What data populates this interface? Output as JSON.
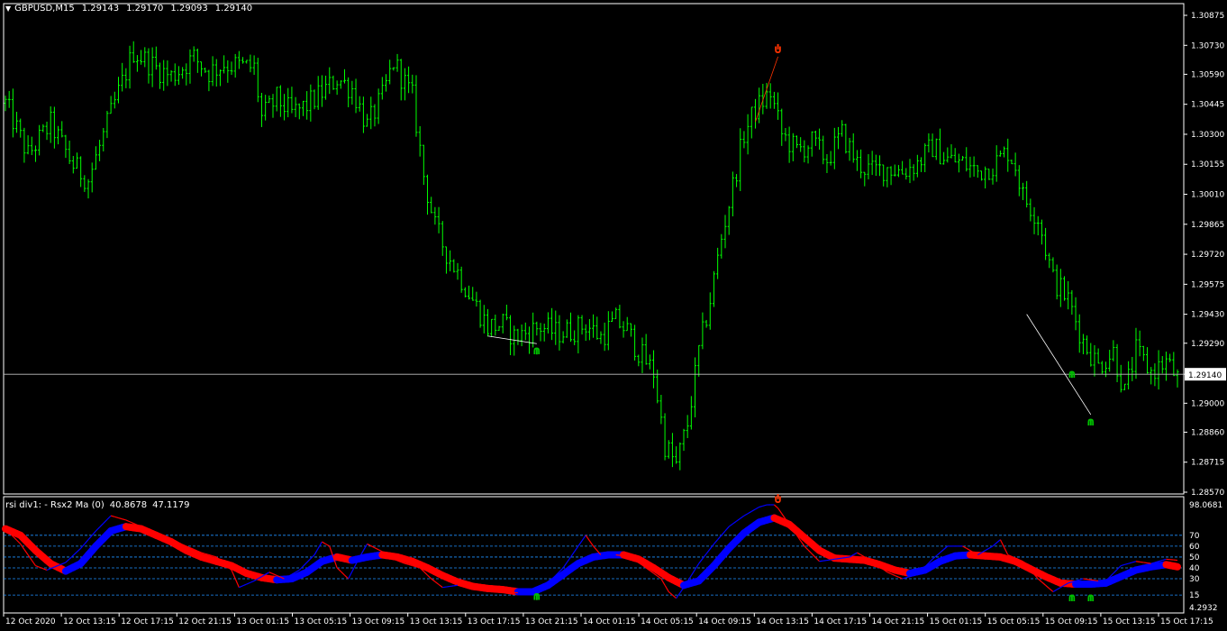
{
  "window": {
    "symbol": "GBPUSD,M15",
    "ohlc": [
      "1.29143",
      "1.29170",
      "1.29093",
      "1.29140"
    ]
  },
  "indicator": {
    "name": "rsi div1: - Rsx2 Ma (0)",
    "values": [
      "40.8678",
      "47.1179"
    ],
    "scale_max": "98.0681",
    "scale_min": "4.2932",
    "levels": [
      {
        "label": "70",
        "value": 70
      },
      {
        "label": "60",
        "value": 60
      },
      {
        "label": "50",
        "value": 50
      },
      {
        "label": "40",
        "value": 40
      },
      {
        "label": "30",
        "value": 30
      },
      {
        "label": "15",
        "value": 15
      }
    ]
  },
  "colors": {
    "background": "#000000",
    "candles": "#00ff00",
    "grid_border": "#ffffff",
    "current_price_line": "#c0c0c0",
    "rsx_up": "#0000ff",
    "rsx_down": "#ff0000",
    "level_lines": "#1e90ff",
    "arrow_up": "#00c000",
    "arrow_down": "#ff3300"
  },
  "chart_data": [
    {
      "type": "candlestick",
      "title": "GBPUSD,M15",
      "y_ticks": [
        "1.30875",
        "1.30730",
        "1.30590",
        "1.30445",
        "1.30300",
        "1.30155",
        "1.30010",
        "1.29865",
        "1.29720",
        "1.29575",
        "1.29430",
        "1.29290",
        "1.29140",
        "1.29000",
        "1.28860",
        "1.28715",
        "1.28570"
      ],
      "ylim": [
        1.2857,
        1.3098
      ],
      "current_price": "1.29140",
      "x_ticks": [
        "12 Oct 2020",
        "12 Oct 13:15",
        "12 Oct 17:15",
        "12 Oct 21:15",
        "13 Oct 01:15",
        "13 Oct 05:15",
        "13 Oct 09:15",
        "13 Oct 13:15",
        "13 Oct 17:15",
        "13 Oct 21:15",
        "14 Oct 01:15",
        "14 Oct 05:15",
        "14 Oct 09:15",
        "14 Oct 13:15",
        "14 Oct 17:15",
        "14 Oct 21:15",
        "15 Oct 01:15",
        "15 Oct 05:15",
        "15 Oct 09:15",
        "15 Oct 13:15",
        "15 Oct 17:15"
      ],
      "price_path": [
        [
          0,
          1.3045
        ],
        [
          6,
          1.302
        ],
        [
          12,
          1.3035
        ],
        [
          18,
          1.3015
        ],
        [
          22,
          1.3008
        ],
        [
          28,
          1.304
        ],
        [
          34,
          1.307
        ],
        [
          40,
          1.3062
        ],
        [
          44,
          1.3058
        ],
        [
          50,
          1.3067
        ],
        [
          54,
          1.306
        ],
        [
          58,
          1.3064
        ],
        [
          62,
          1.3063
        ],
        [
          66,
          1.3062
        ],
        [
          68,
          1.3038
        ],
        [
          72,
          1.3047
        ],
        [
          76,
          1.304
        ],
        [
          80,
          1.3044
        ],
        [
          84,
          1.305
        ],
        [
          88,
          1.3057
        ],
        [
          92,
          1.3052
        ],
        [
          96,
          1.3034
        ],
        [
          100,
          1.3048
        ],
        [
          103,
          1.3065
        ],
        [
          108,
          1.3048
        ],
        [
          111,
          1.301
        ],
        [
          114,
          1.2985
        ],
        [
          117,
          1.2973
        ],
        [
          121,
          1.296
        ],
        [
          124,
          1.295
        ],
        [
          128,
          1.2937
        ],
        [
          132,
          1.2938
        ],
        [
          135,
          1.2932
        ],
        [
          138,
          1.2934
        ],
        [
          142,
          1.2937
        ],
        [
          146,
          1.2934
        ],
        [
          150,
          1.2935
        ],
        [
          154,
          1.2938
        ],
        [
          158,
          1.2932
        ],
        [
          162,
          1.294
        ],
        [
          165,
          1.2935
        ],
        [
          168,
          1.2925
        ],
        [
          172,
          1.2915
        ],
        [
          175,
          1.288
        ],
        [
          178,
          1.287
        ],
        [
          181,
          1.289
        ],
        [
          184,
          1.2925
        ],
        [
          187,
          1.295
        ],
        [
          190,
          1.298
        ],
        [
          193,
          1.3005
        ],
        [
          196,
          1.303
        ],
        [
          199,
          1.3042
        ],
        [
          203,
          1.305
        ],
        [
          206,
          1.303
        ],
        [
          210,
          1.3022
        ],
        [
          214,
          1.3026
        ],
        [
          218,
          1.3018
        ],
        [
          222,
          1.303
        ],
        [
          226,
          1.3016
        ],
        [
          230,
          1.3012
        ],
        [
          234,
          1.3014
        ],
        [
          238,
          1.3012
        ],
        [
          242,
          1.3016
        ],
        [
          246,
          1.3024
        ],
        [
          250,
          1.3018
        ],
        [
          254,
          1.3016
        ],
        [
          258,
          1.3012
        ],
        [
          262,
          1.3015
        ],
        [
          266,
          1.3022
        ],
        [
          268,
          1.3015
        ],
        [
          270,
          1.3
        ],
        [
          274,
          1.299
        ],
        [
          278,
          1.296
        ],
        [
          282,
          1.295
        ],
        [
          286,
          1.293
        ],
        [
          290,
          1.2918
        ],
        [
          294,
          1.2925
        ],
        [
          297,
          1.2905
        ],
        [
          300,
          1.2925
        ],
        [
          304,
          1.2915
        ],
        [
          308,
          1.292
        ],
        [
          311,
          1.2912
        ]
      ],
      "arrows": [
        {
          "direction": "up",
          "bar": 141,
          "price": 1.29288
        },
        {
          "direction": "down",
          "bar": 205,
          "price": 1.30675
        },
        {
          "direction": "up",
          "bar": 283,
          "price": 1.29175
        },
        {
          "direction": "up",
          "bar": 288,
          "price": 1.28945
        }
      ],
      "divergence_lines": [
        {
          "color": "#ffffff",
          "from": [
            128,
            1.29325
          ],
          "to": [
            141,
            1.29288
          ]
        },
        {
          "color": "#ff3300",
          "from": [
            199,
            1.3036
          ],
          "to": [
            205,
            1.30675
          ]
        },
        {
          "color": "#ffffff",
          "from": [
            271,
            1.2943
          ],
          "to": [
            288,
            1.28945
          ]
        }
      ]
    },
    {
      "type": "line",
      "title": "rsi div1: - Rsx2 Ma (0)",
      "ylim": [
        4.2932,
        98.0681
      ],
      "series": [
        {
          "role": "rsx",
          "points": [
            [
              0,
              76
            ],
            [
              4,
              62
            ],
            [
              8,
              42
            ],
            [
              11,
              38
            ],
            [
              16,
              45
            ],
            [
              20,
              58
            ],
            [
              24,
              74
            ],
            [
              28,
              88
            ],
            [
              32,
              84
            ],
            [
              36,
              78
            ],
            [
              40,
              72
            ],
            [
              44,
              66
            ],
            [
              48,
              60
            ],
            [
              52,
              54
            ],
            [
              56,
              50
            ],
            [
              60,
              38
            ],
            [
              62,
              22
            ],
            [
              66,
              28
            ],
            [
              70,
              36
            ],
            [
              74,
              30
            ],
            [
              78,
              38
            ],
            [
              82,
              52
            ],
            [
              84,
              64
            ],
            [
              86,
              60
            ],
            [
              88,
              40
            ],
            [
              91,
              30
            ],
            [
              94,
              50
            ],
            [
              96,
              62
            ],
            [
              100,
              55
            ],
            [
              103,
              48
            ],
            [
              106,
              44
            ],
            [
              110,
              40
            ],
            [
              113,
              30
            ],
            [
              116,
              22
            ],
            [
              120,
              24
            ],
            [
              124,
              20
            ],
            [
              128,
              19
            ],
            [
              132,
              18
            ],
            [
              136,
              17
            ],
            [
              140,
              18
            ],
            [
              144,
              26
            ],
            [
              148,
              40
            ],
            [
              152,
              60
            ],
            [
              154,
              70
            ],
            [
              156,
              60
            ],
            [
              158,
              52
            ],
            [
              162,
              52
            ],
            [
              166,
              50
            ],
            [
              170,
              40
            ],
            [
              174,
              30
            ],
            [
              176,
              18
            ],
            [
              178,
              12
            ],
            [
              180,
              22
            ],
            [
              184,
              44
            ],
            [
              188,
              62
            ],
            [
              192,
              78
            ],
            [
              196,
              88
            ],
            [
              200,
              96
            ],
            [
              204,
              100
            ],
            [
              208,
              80
            ],
            [
              212,
              60
            ],
            [
              216,
              46
            ],
            [
              220,
              48
            ],
            [
              224,
              50
            ],
            [
              226,
              54
            ],
            [
              230,
              46
            ],
            [
              234,
              36
            ],
            [
              238,
              30
            ],
            [
              242,
              34
            ],
            [
              246,
              48
            ],
            [
              250,
              60
            ],
            [
              254,
              60
            ],
            [
              258,
              52
            ],
            [
              262,
              60
            ],
            [
              264,
              66
            ],
            [
              266,
              52
            ],
            [
              270,
              46
            ],
            [
              274,
              30
            ],
            [
              278,
              18
            ],
            [
              282,
              26
            ],
            [
              286,
              30
            ],
            [
              290,
              28
            ],
            [
              292,
              28
            ],
            [
              296,
              42
            ],
            [
              300,
              46
            ],
            [
              304,
              44
            ],
            [
              308,
              48
            ],
            [
              311,
              47
            ]
          ]
        },
        {
          "role": "rsx_ma",
          "points": [
            [
              0,
              76
            ],
            [
              4,
              70
            ],
            [
              8,
              56
            ],
            [
              12,
              44
            ],
            [
              16,
              37
            ],
            [
              20,
              44
            ],
            [
              24,
              60
            ],
            [
              28,
              74
            ],
            [
              32,
              78
            ],
            [
              36,
              76
            ],
            [
              40,
              70
            ],
            [
              44,
              64
            ],
            [
              48,
              56
            ],
            [
              52,
              50
            ],
            [
              56,
              46
            ],
            [
              60,
              42
            ],
            [
              64,
              35
            ],
            [
              68,
              31
            ],
            [
              72,
              29
            ],
            [
              76,
              30
            ],
            [
              80,
              36
            ],
            [
              84,
              46
            ],
            [
              88,
              50
            ],
            [
              92,
              47
            ],
            [
              96,
              50
            ],
            [
              100,
              52
            ],
            [
              104,
              50
            ],
            [
              108,
              46
            ],
            [
              112,
              40
            ],
            [
              116,
              33
            ],
            [
              120,
              27
            ],
            [
              124,
              23
            ],
            [
              128,
              21
            ],
            [
              132,
              20
            ],
            [
              136,
              18
            ],
            [
              140,
              18
            ],
            [
              144,
              24
            ],
            [
              148,
              34
            ],
            [
              152,
              44
            ],
            [
              156,
              50
            ],
            [
              160,
              52
            ],
            [
              164,
              52
            ],
            [
              168,
              48
            ],
            [
              172,
              40
            ],
            [
              176,
              31
            ],
            [
              180,
              24
            ],
            [
              184,
              28
            ],
            [
              188,
              42
            ],
            [
              192,
              58
            ],
            [
              196,
              72
            ],
            [
              200,
              82
            ],
            [
              204,
              86
            ],
            [
              208,
              80
            ],
            [
              212,
              68
            ],
            [
              216,
              56
            ],
            [
              220,
              49
            ],
            [
              224,
              48
            ],
            [
              228,
              47
            ],
            [
              232,
              43
            ],
            [
              236,
              38
            ],
            [
              240,
              35
            ],
            [
              244,
              38
            ],
            [
              248,
              46
            ],
            [
              252,
              51
            ],
            [
              256,
              52
            ],
            [
              260,
              51
            ],
            [
              264,
              50
            ],
            [
              268,
              46
            ],
            [
              272,
              39
            ],
            [
              276,
              32
            ],
            [
              280,
              26
            ],
            [
              284,
              25
            ],
            [
              288,
              25
            ],
            [
              292,
              26
            ],
            [
              296,
              32
            ],
            [
              300,
              38
            ],
            [
              304,
              41
            ],
            [
              308,
              43
            ],
            [
              311,
              41
            ]
          ]
        }
      ],
      "signal_arrows": [
        {
          "direction": "down",
          "bar": 205,
          "value": 98
        },
        {
          "direction": "up",
          "bar": 141,
          "value": 17
        },
        {
          "direction": "up",
          "bar": 283,
          "value": 16
        },
        {
          "direction": "up",
          "bar": 288,
          "value": 16
        }
      ]
    }
  ]
}
